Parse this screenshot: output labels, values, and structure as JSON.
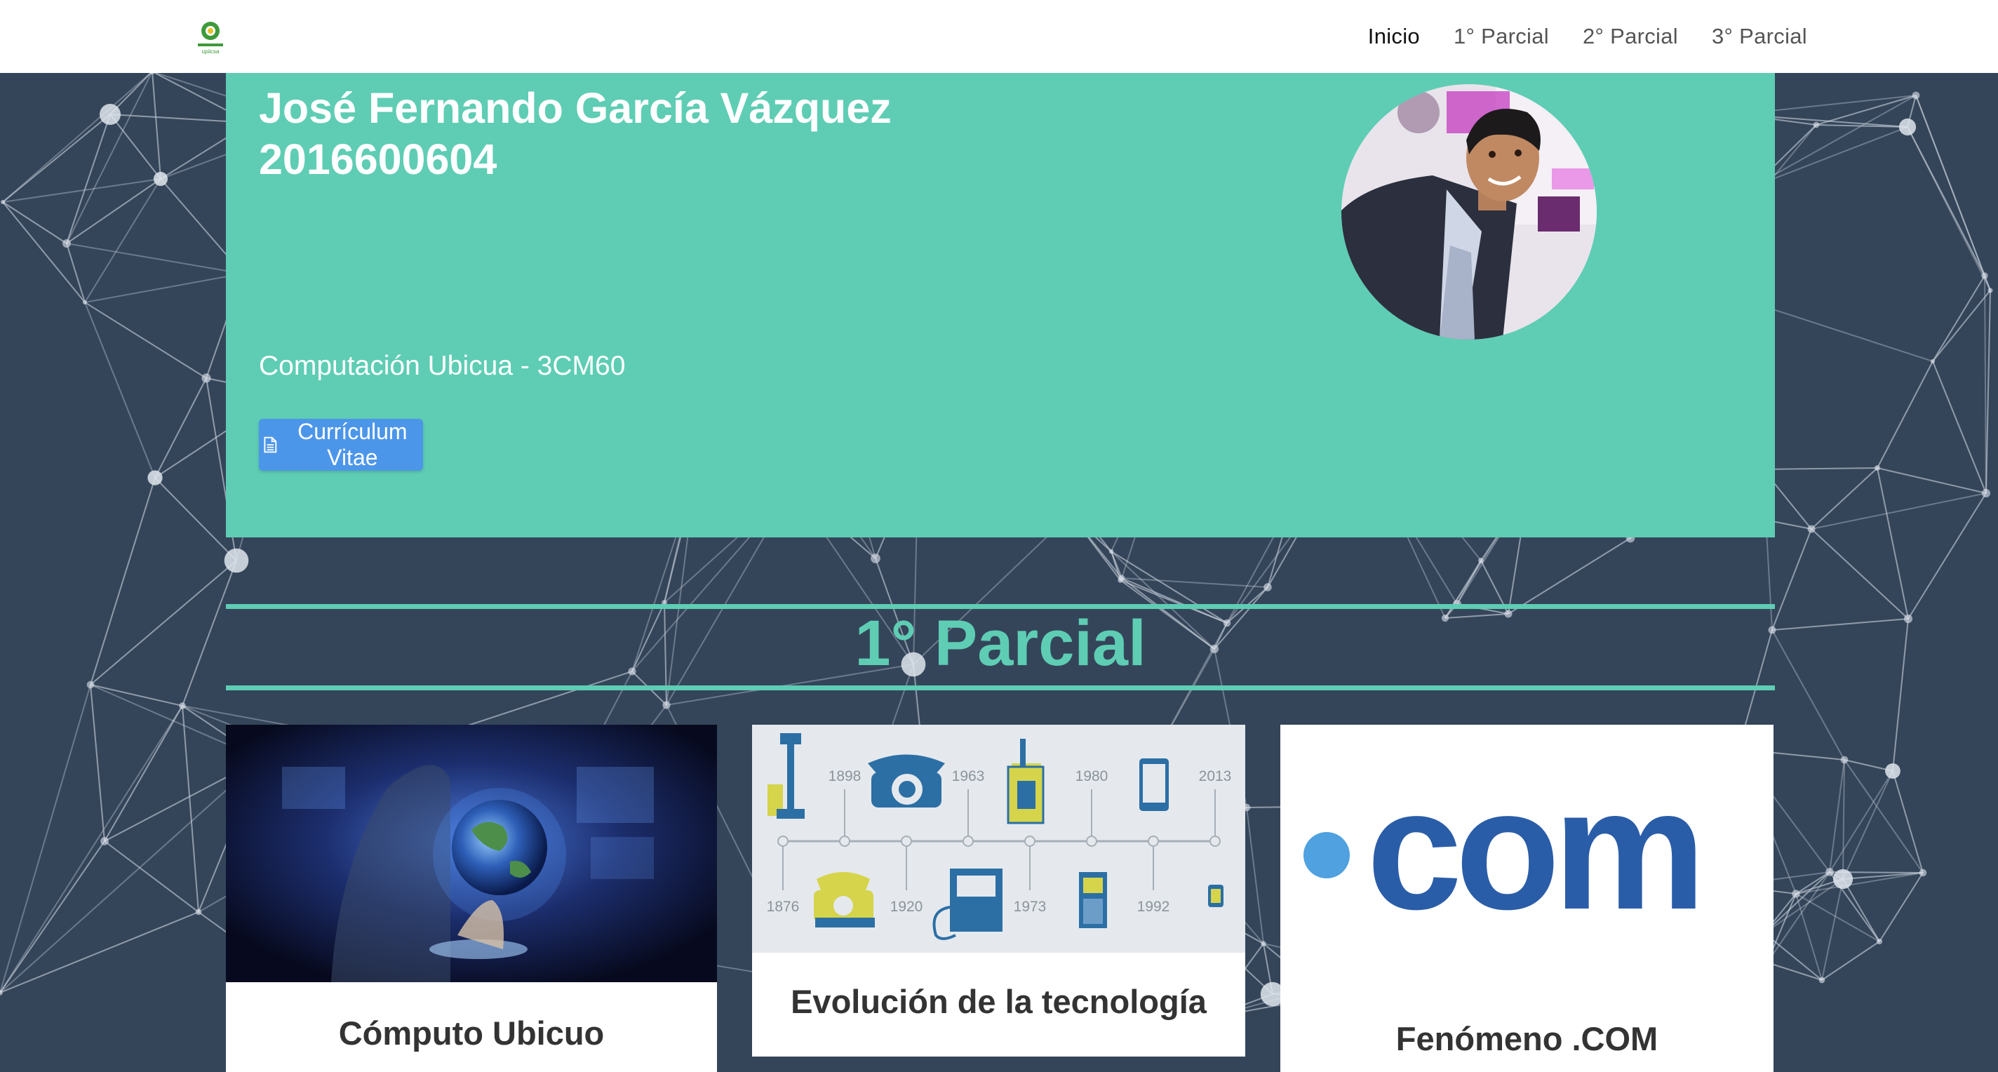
{
  "navbar": {
    "logo_text": "upiicsa",
    "links": [
      {
        "label": "Inicio",
        "active": true
      },
      {
        "label": "1° Parcial",
        "active": false
      },
      {
        "label": "2° Parcial",
        "active": false
      },
      {
        "label": "3° Parcial",
        "active": false
      }
    ]
  },
  "hero": {
    "name": "José Fernando García Vázquez",
    "id_number": "2016600604",
    "subtitle": "Computación Ubicua - 3CM60",
    "cv_button_label": "Currículum Vitae"
  },
  "section": {
    "title": "1° Parcial"
  },
  "cards": [
    {
      "title": "Cómputo Ubicuo"
    },
    {
      "title": "Evolución de la tecnología",
      "timeline_years_top": [
        "1898",
        "1963",
        "1980",
        "2013"
      ],
      "timeline_years_bottom": [
        "1876",
        "1920",
        "1973",
        "1992"
      ]
    },
    {
      "title": "Fenómeno .COM",
      "logo_text": "com"
    }
  ],
  "colors": {
    "accent": "#5ecdb4",
    "background": "#34455a",
    "button": "#4c96e9",
    "com_blue": "#2a5da8"
  }
}
